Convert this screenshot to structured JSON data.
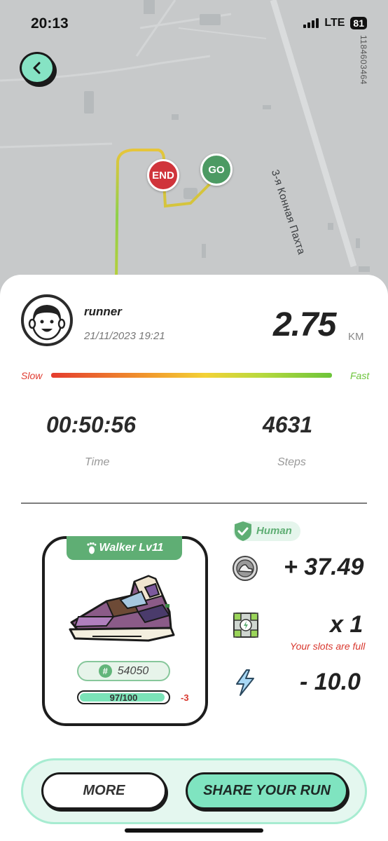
{
  "status_bar": {
    "time": "20:13",
    "network": "LTE",
    "battery": "81"
  },
  "map": {
    "street_name": "3-я Конная Пахта",
    "vertical_code": "1184603464",
    "end_pin": "END",
    "go_pin": "GO"
  },
  "run": {
    "username": "runner",
    "datetime": "21/11/2023 19:21",
    "distance": "2.75",
    "distance_unit": "KM",
    "slow_label": "Slow",
    "fast_label": "Fast",
    "time": "00:50:56",
    "time_label": "Time",
    "steps": "4631",
    "steps_label": "Steps"
  },
  "sneaker": {
    "level_label": "Walker Lv11",
    "id": "54050",
    "durability_text": "97/100",
    "durability_fraction": 0.97,
    "durability_change": "-3"
  },
  "rewards": {
    "human_badge": "Human",
    "earned": "+ 37.49",
    "mystery_box": "x 1",
    "slots_note": "Your slots are full",
    "energy": "- 10.0"
  },
  "actions": {
    "more": "MORE",
    "share": "SHARE YOUR RUN"
  },
  "colors": {
    "accent_mint": "#7fe4c0",
    "end_red": "#d0343b",
    "go_green": "#4c9a63",
    "alert_red": "#d9382f"
  }
}
